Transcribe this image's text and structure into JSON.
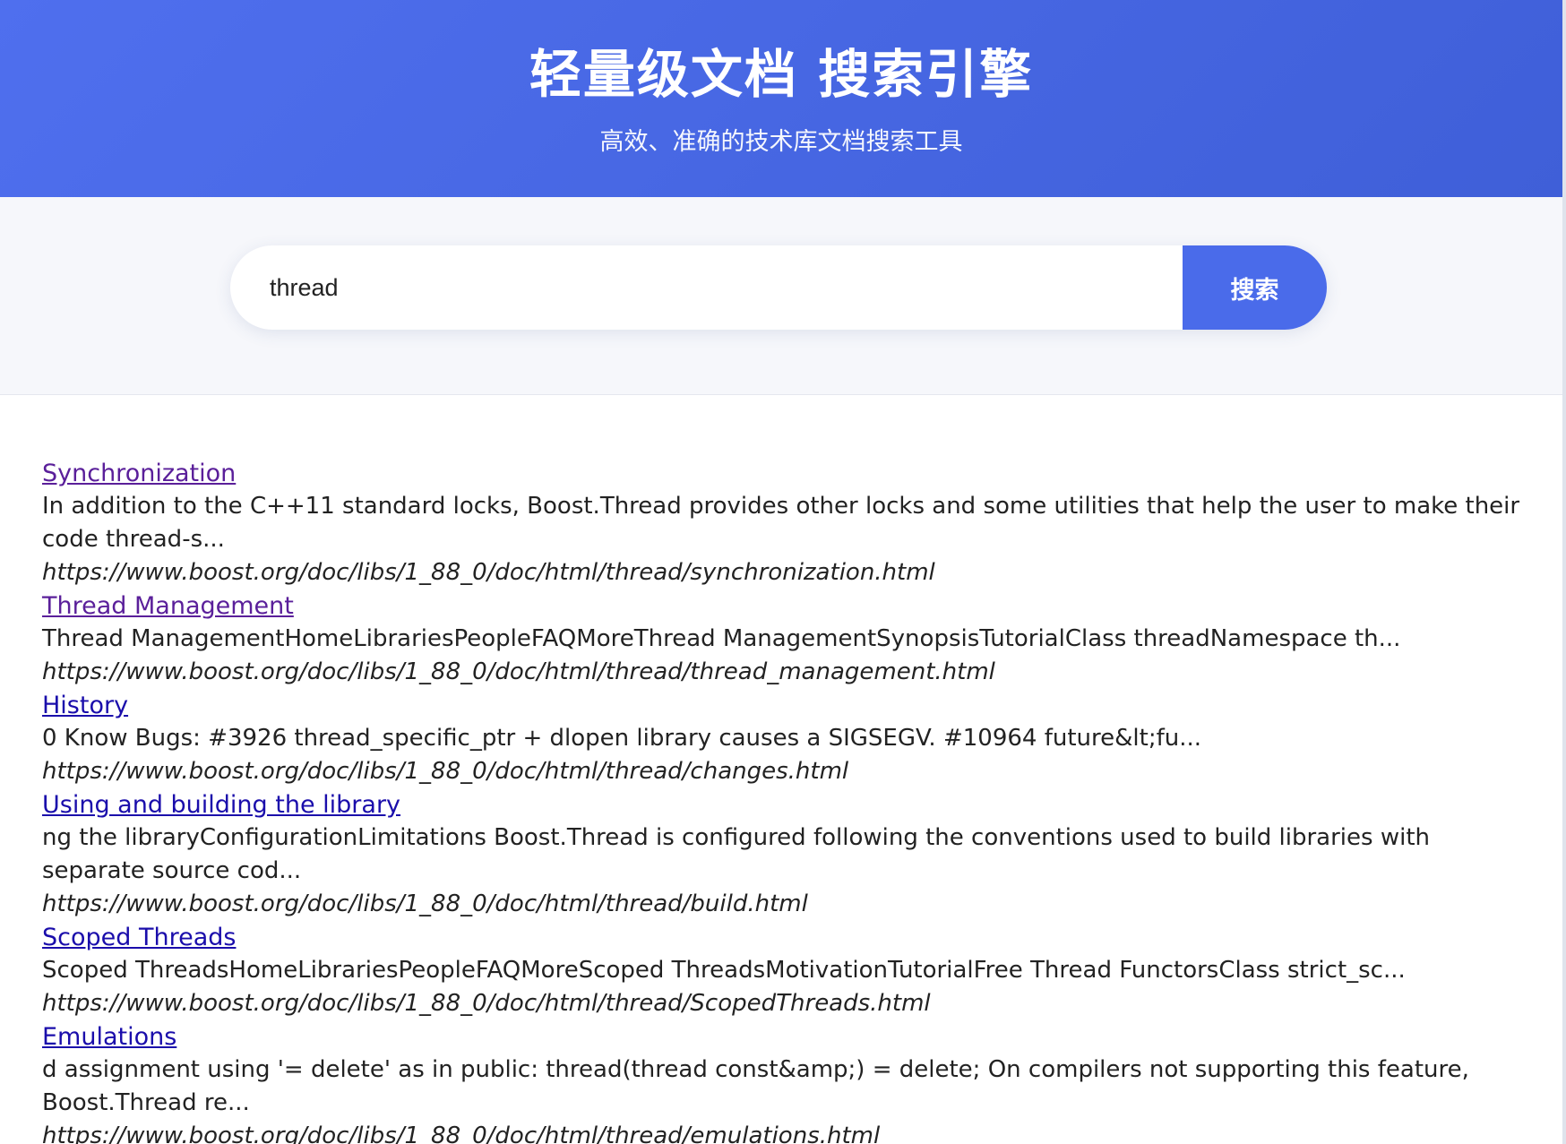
{
  "header": {
    "title": "轻量级文档 搜索引擎",
    "subtitle": "高效、准确的技术库文档搜索工具"
  },
  "search": {
    "value": "thread",
    "button_label": "搜索"
  },
  "results": [
    {
      "title": "Synchronization",
      "visited": true,
      "snippet": "In addition to the C++11 standard locks, Boost.Thread provides other locks and some utilities that help the user to make their code thread-s...",
      "url": "https://www.boost.org/doc/libs/1_88_0/doc/html/thread/synchronization.html"
    },
    {
      "title": "Thread Management",
      "visited": true,
      "snippet": "Thread ManagementHomeLibrariesPeopleFAQMoreThread ManagementSynopsisTutorialClass threadNamespace th...",
      "url": "https://www.boost.org/doc/libs/1_88_0/doc/html/thread/thread_management.html"
    },
    {
      "title": "History",
      "visited": false,
      "snippet": "0 Know Bugs: #3926 thread_specific_ptr + dlopen library causes a SIGSEGV. #10964 future&lt;fu...",
      "url": "https://www.boost.org/doc/libs/1_88_0/doc/html/thread/changes.html"
    },
    {
      "title": "Using and building the library",
      "visited": false,
      "snippet": "ng the libraryConfigurationLimitations Boost.Thread is configured following the conventions used to build libraries with separate source cod...",
      "url": "https://www.boost.org/doc/libs/1_88_0/doc/html/thread/build.html"
    },
    {
      "title": "Scoped Threads",
      "visited": false,
      "snippet": "Scoped ThreadsHomeLibrariesPeopleFAQMoreScoped ThreadsMotivationTutorialFree Thread FunctorsClass strict_sc...",
      "url": "https://www.boost.org/doc/libs/1_88_0/doc/html/thread/ScopedThreads.html"
    },
    {
      "title": "Emulations",
      "visited": false,
      "snippet": "d assignment using '= delete' as in public: thread(thread const&amp;) = delete; On compilers not supporting this feature, Boost.Thread re...",
      "url": "https://www.boost.org/doc/libs/1_88_0/doc/html/thread/emulations.html"
    }
  ]
}
